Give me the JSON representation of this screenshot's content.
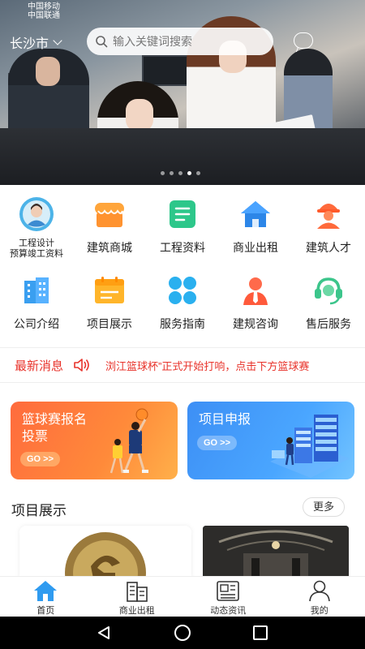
{
  "status_bar": {
    "carrier1": "中国移动",
    "carrier2": "中国联通"
  },
  "topbar": {
    "city": "长沙市",
    "search_placeholder": "输入关键词搜索"
  },
  "grid": {
    "row1": [
      {
        "label": "工程设计\n预算竣工资料",
        "icon": "avatar-icon"
      },
      {
        "label": "建筑商城",
        "icon": "shop-icon"
      },
      {
        "label": "工程资料",
        "icon": "document-icon"
      },
      {
        "label": "商业出租",
        "icon": "house-icon"
      },
      {
        "label": "建筑人才",
        "icon": "worker-icon"
      }
    ],
    "row2": [
      {
        "label": "公司介绍",
        "icon": "building-icon"
      },
      {
        "label": "项目展示",
        "icon": "folder-icon"
      },
      {
        "label": "服务指南",
        "icon": "clover-icon"
      },
      {
        "label": "建规咨询",
        "icon": "person-icon"
      },
      {
        "label": "售后服务",
        "icon": "headset-icon"
      }
    ]
  },
  "news": {
    "title": "最新消息",
    "text": "浏江篮球杯”正式开始打响，点击下方篮球赛"
  },
  "promos": {
    "left": {
      "title_line1": "篮球赛报名",
      "title_line2": "投票",
      "go": "GO >>"
    },
    "right": {
      "title": "项目申报",
      "go": "GO >>"
    }
  },
  "section": {
    "title": "项目展示",
    "more": "更多"
  },
  "tabbar": [
    {
      "label": "首页",
      "icon": "home-icon"
    },
    {
      "label": "商业出租",
      "icon": "building-rent-icon"
    },
    {
      "label": "动态资讯",
      "icon": "news-icon"
    },
    {
      "label": "我的",
      "icon": "user-icon"
    }
  ],
  "colors": {
    "accent": "#1e88e5",
    "news_red": "#e8332b",
    "promo_orange": "#ff7a3a",
    "promo_blue": "#3d8ff5"
  }
}
